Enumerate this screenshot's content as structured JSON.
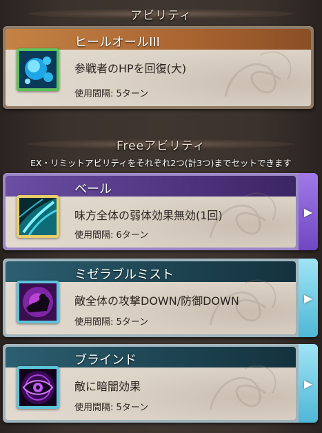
{
  "ability_section": {
    "title": "アビリティ"
  },
  "free_section": {
    "title": "Freeアビリティ",
    "note": "EX・リミットアビリティをそれぞれ2つ(計3つ)までセットできます"
  },
  "abilities": [
    {
      "name": "ヒールオールIII",
      "description": "参戦者のHPを回復(大)",
      "cooldown": "使用間隔: 5ターン",
      "icon": "heal-orb-icon",
      "band_color": "#b8733a",
      "frame_color": "#5ec15a"
    }
  ],
  "free_abilities": [
    {
      "name": "ベール",
      "description": "味方全体の弱体効果無効(1回)",
      "cooldown": "使用間隔: 6ターン",
      "icon": "veil-icon",
      "band_color": "#5b3f8e",
      "frame_color": "#e9cf6a",
      "tab_color": "#8b63d6",
      "arrow": "▶"
    },
    {
      "name": "ミゼラブルミスト",
      "description": "敵全体の攻撃DOWN/防御DOWN",
      "cooldown": "使用間隔: 5ターン",
      "icon": "miserable-mist-icon",
      "band_color": "#1f4a5a",
      "frame_color": "#5fc3da",
      "tab_color": "#7ed4ea",
      "arrow": "▶"
    },
    {
      "name": "ブラインド",
      "description": "敵に暗闇効果",
      "cooldown": "使用間隔: 5ターン",
      "icon": "blind-eye-icon",
      "band_color": "#1f4a5a",
      "frame_color": "#5fc3da",
      "tab_color": "#7ed4ea",
      "arrow": "▶"
    }
  ]
}
